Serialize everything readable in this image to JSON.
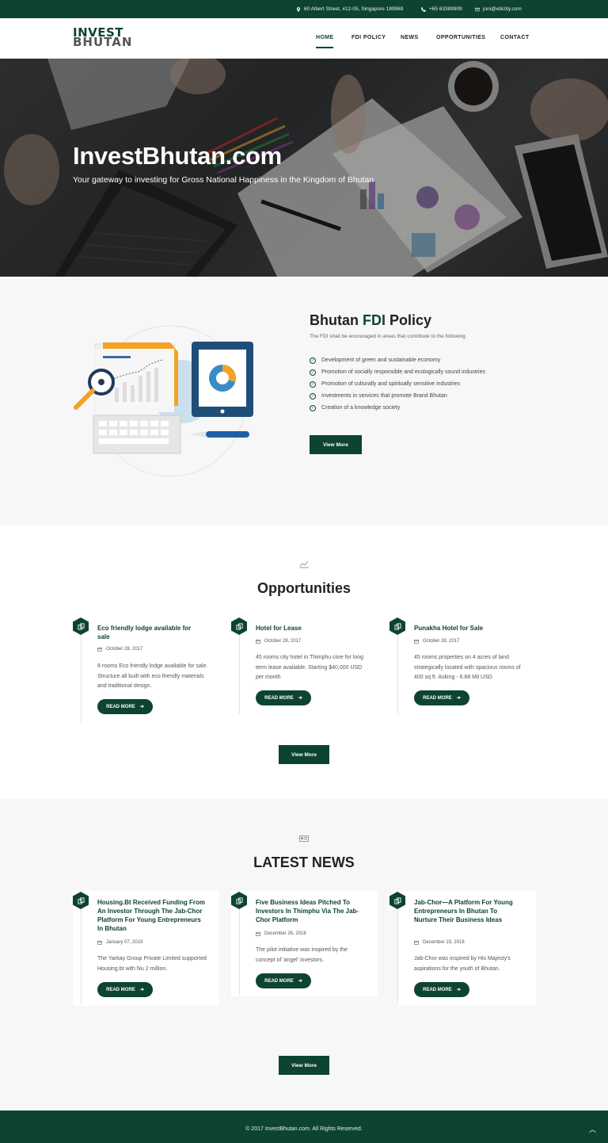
{
  "topbar": {
    "address": "60 Albert Street, #12-05, Singapore 189969",
    "phone": "+65 63389909",
    "email": "joni@ebizity.com"
  },
  "logo": {
    "line1": "INVEST",
    "line2": "BHUTAN"
  },
  "nav": {
    "items": [
      {
        "label": "HOME"
      },
      {
        "label": "FDI POLICY"
      },
      {
        "label": "NEWS"
      },
      {
        "label": "OPPORTUNITIES"
      },
      {
        "label": "CONTACT"
      }
    ]
  },
  "hero": {
    "title": "InvestBhutan.com",
    "subtitle": "Your gateway to investing for Gross National Happiness in the Kingdom of Bhutan"
  },
  "fdi": {
    "title_pre": "Bhutan ",
    "title_accent": "FDI",
    "title_post": " Policy",
    "subtitle": "The FDI shall be encouraged in areas that contribute to the following",
    "items": [
      "Development of green and sustainable economy",
      "Promotion of socially responsible and ecologically sound industries",
      "Promotion of culturally and spiritually sensitive industries",
      "Investments in services that promote Brand Bhutan",
      "Creation of a knowledge society"
    ],
    "button": "View More"
  },
  "opportunities": {
    "title": "Opportunities",
    "cards": [
      {
        "title": "Eco friendly lodge available for sale",
        "date": "October 28, 2017",
        "text": "8 rooms Eco friendly lodge available for sale. Structure all built with eco friendly materials and traditional design.",
        "button": "READ MORE"
      },
      {
        "title": "Hotel for Lease",
        "date": "October 28, 2017",
        "text": "45 rooms city hotel in Thimphu core for long term lease available. Starting $40,000 USD per month",
        "button": "READ MORE"
      },
      {
        "title": "Punakha Hotel for Sale",
        "date": "October 28, 2017",
        "text": "45 rooms properties on 4 acres of land strategically located with spacious rooms of 400 sq ft. Asking - 6.88 Mil USD",
        "button": "READ MORE"
      }
    ],
    "button": "View More"
  },
  "news": {
    "title": "LATEST NEWS",
    "cards": [
      {
        "title": "Housing.Bt Received Funding From An Investor Through The Jab-Chor Platform For Young Entrepreneurs In Bhutan",
        "date": "January 07, 2019",
        "text": "The Yarkay Group Private Limited supported Housing.bt with Nu 2 million.",
        "button": "READ MORE"
      },
      {
        "title": "Five Business Ideas Pitched To Investors In Thimphu Via The Jab-Chor Platform",
        "date": "December 26, 2018",
        "text": "The pilot initiative was inspired by the concept of 'angel' investors.",
        "button": "READ MORE"
      },
      {
        "title": "Jab-Chor—A Platform For Young Entrepreneurs In Bhutan To Nurture Their Business Ideas",
        "date": "December 19, 2018",
        "text": "Jab-Chor was inspired by His Majesty's aspirations for the youth of Bhutan.",
        "button": "READ MORE"
      }
    ],
    "button": "View More"
  },
  "footer": {
    "copyright": "© 2017 InvestBhutan.com. All Rights Reserved."
  },
  "colors": {
    "brand": "#0d4430",
    "section_bg": "#f7f7f7"
  }
}
